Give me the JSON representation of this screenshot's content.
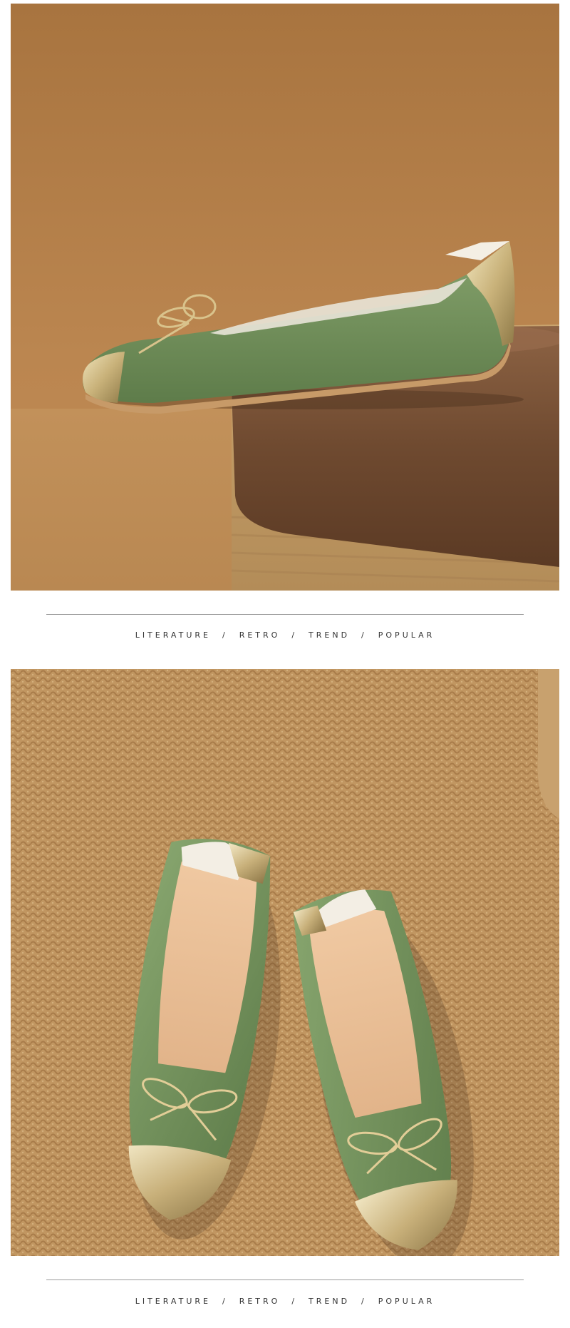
{
  "photos": [
    {
      "subject": "green ballet flat with gold toe cap and bow on leather ottoman"
    },
    {
      "subject": "pair of green ballet flats with gold toe caps on woven jute rug"
    }
  ],
  "taglines": [
    {
      "words": [
        "LITERATURE",
        "RETRO",
        "TREND",
        "POPULAR"
      ],
      "separator": "/"
    },
    {
      "words": [
        "LITERATURE",
        "RETRO",
        "TREND",
        "POPULAR"
      ],
      "separator": "/"
    }
  ],
  "colors": {
    "backdrop": "#b07a42",
    "shoe_green": "#6f8e5a",
    "gold_cap": "#d8c48a",
    "ottoman_leather": "#7a5236",
    "rug": "#c49a66"
  }
}
